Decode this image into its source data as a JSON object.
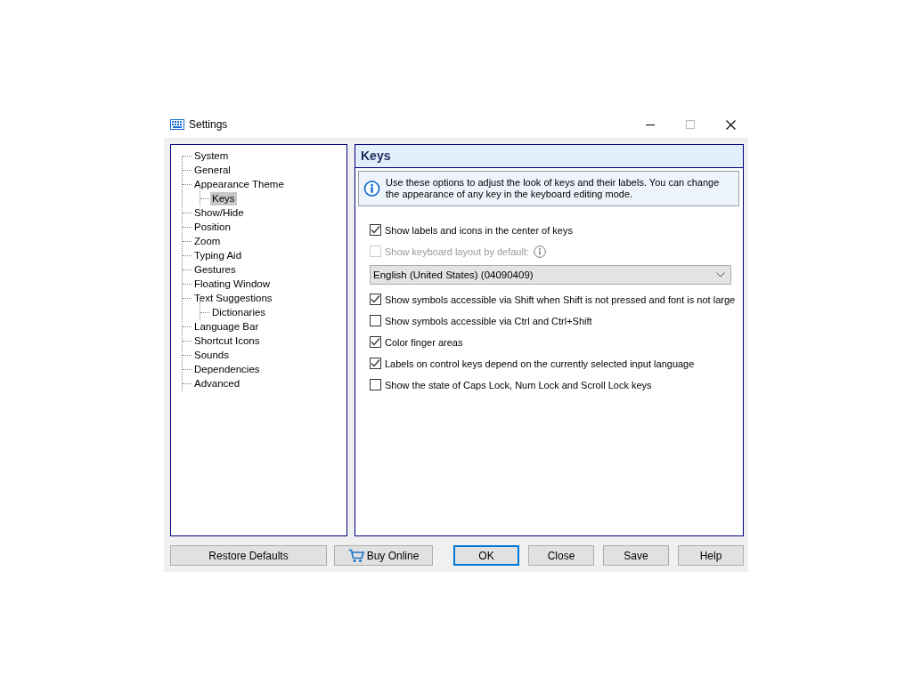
{
  "window": {
    "title": "Settings"
  },
  "tree": [
    {
      "label": "System",
      "selected": false
    },
    {
      "label": "General",
      "selected": false
    },
    {
      "label": "Appearance Theme",
      "selected": false,
      "children": [
        {
          "label": "Keys",
          "selected": true
        }
      ]
    },
    {
      "label": "Show/Hide",
      "selected": false
    },
    {
      "label": "Position",
      "selected": false
    },
    {
      "label": "Zoom",
      "selected": false
    },
    {
      "label": "Typing Aid",
      "selected": false
    },
    {
      "label": "Gestures",
      "selected": false
    },
    {
      "label": "Floating Window",
      "selected": false
    },
    {
      "label": "Text Suggestions",
      "selected": false,
      "children": [
        {
          "label": "Dictionaries",
          "selected": false
        }
      ]
    },
    {
      "label": "Language Bar",
      "selected": false
    },
    {
      "label": "Shortcut Icons",
      "selected": false
    },
    {
      "label": "Sounds",
      "selected": false
    },
    {
      "label": "Dependencies",
      "selected": false
    },
    {
      "label": "Advanced",
      "selected": false
    }
  ],
  "panel": {
    "title": "Keys",
    "info": "Use these options to adjust the look of keys and their labels. You can change the appearance of any key in the keyboard editing mode."
  },
  "options": [
    {
      "kind": "checkbox",
      "label": "Show labels and icons in the center of keys",
      "checked": true,
      "disabled": false,
      "info": false
    },
    {
      "kind": "checkbox",
      "label": "Show keyboard layout by default:",
      "checked": false,
      "disabled": true,
      "info": true
    },
    {
      "kind": "dropdown",
      "value": "English (United States) (04090409)"
    },
    {
      "kind": "checkbox",
      "label": "Show symbols accessible via Shift when Shift is not pressed and font is not large",
      "checked": true,
      "disabled": false,
      "info": false
    },
    {
      "kind": "checkbox",
      "label": "Show symbols accessible via Ctrl and Ctrl+Shift",
      "checked": false,
      "disabled": false,
      "info": false
    },
    {
      "kind": "checkbox",
      "label": "Color finger areas",
      "checked": true,
      "disabled": false,
      "info": false
    },
    {
      "kind": "checkbox",
      "label": "Labels on control keys depend on the currently selected input language",
      "checked": true,
      "disabled": false,
      "info": false
    },
    {
      "kind": "checkbox",
      "label": "Show the state of Caps Lock, Num Lock and Scroll Lock keys",
      "checked": false,
      "disabled": false,
      "info": false
    }
  ],
  "left_button": {
    "label": "Restore Defaults"
  },
  "buttons": [
    {
      "label": "Buy Online",
      "icon": true,
      "default": false
    },
    {
      "label": "OK",
      "icon": false,
      "default": true
    },
    {
      "label": "Close",
      "icon": false,
      "default": false
    },
    {
      "label": "Save",
      "icon": false,
      "default": false
    },
    {
      "label": "Help",
      "icon": false,
      "default": false
    }
  ]
}
